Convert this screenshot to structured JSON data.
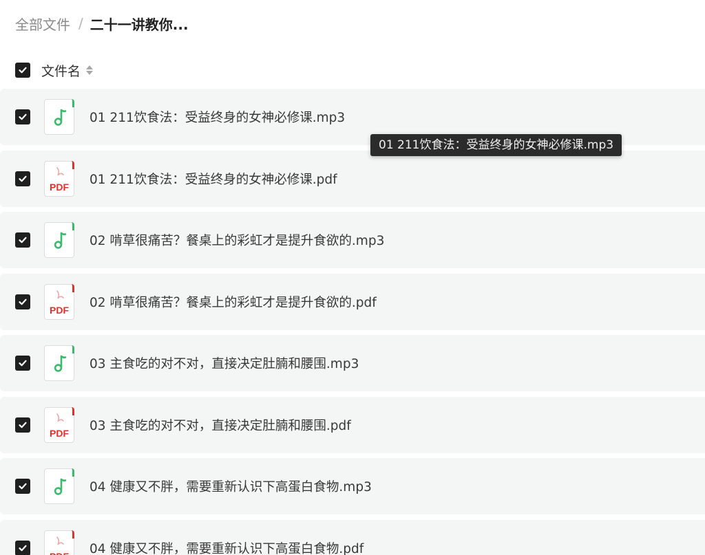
{
  "breadcrumb": {
    "root": "全部文件",
    "separator": "/",
    "current": "二十一讲教你..."
  },
  "list_header": {
    "label": "文件名",
    "select_all_checked": true,
    "sort_icon": "sort-icon"
  },
  "files": [
    {
      "name": "01 211饮食法：受益终身的女神必修课.mp3",
      "type": "audio",
      "checked": true
    },
    {
      "name": "01 211饮食法：受益终身的女神必修课.pdf",
      "type": "pdf",
      "checked": true
    },
    {
      "name": "02 啃草很痛苦？餐桌上的彩虹才是提升食欲的.mp3",
      "type": "audio",
      "checked": true
    },
    {
      "name": "02 啃草很痛苦？餐桌上的彩虹才是提升食欲的.pdf",
      "type": "pdf",
      "checked": true
    },
    {
      "name": "03 主食吃的对不对，直接决定肚腩和腰围.mp3",
      "type": "audio",
      "checked": true
    },
    {
      "name": "03 主食吃的对不对，直接决定肚腩和腰围.pdf",
      "type": "pdf",
      "checked": true
    },
    {
      "name": "04 健康又不胖，需要重新认识下高蛋白食物.mp3",
      "type": "audio",
      "checked": true
    },
    {
      "name": "04 健康又不胖，需要重新认识下高蛋白食物.pdf",
      "type": "pdf",
      "checked": true
    }
  ],
  "tooltip": {
    "text": "01 211饮食法：受益终身的女神必修课.mp3"
  },
  "icons": {
    "audio": "music-note-icon",
    "pdf": "pdf-file-icon",
    "checkbox": "check-icon"
  },
  "colors": {
    "audio_accent": "#3cba6b",
    "pdf_accent": "#e0312b",
    "row_background": "#f4f5f5",
    "checkbox": "#1f1f1f",
    "tooltip_background": "#2b2b2b"
  }
}
